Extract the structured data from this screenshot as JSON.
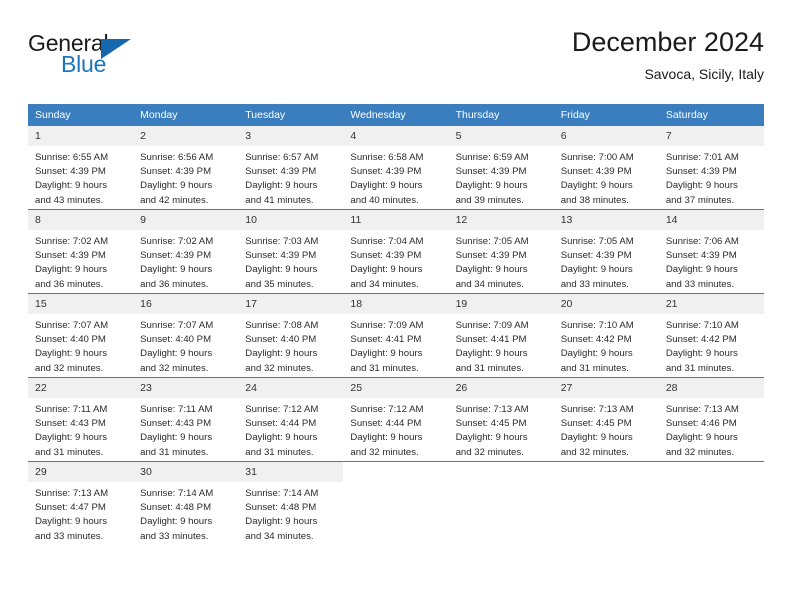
{
  "brand": {
    "name_top": "General",
    "name_bottom": "Blue",
    "flag_icon": "blue-triangle-flag",
    "accent_color": "#1567ae",
    "header_color": "#3a7ebf"
  },
  "header": {
    "title": "December 2024",
    "subtitle": "Savoca, Sicily, Italy"
  },
  "weekdays": [
    "Sunday",
    "Monday",
    "Tuesday",
    "Wednesday",
    "Thursday",
    "Friday",
    "Saturday"
  ],
  "weeks": [
    [
      {
        "day": "1",
        "sunrise": "Sunrise: 6:55 AM",
        "sunset": "Sunset: 4:39 PM",
        "daylight_line1": "Daylight: 9 hours",
        "daylight_line2": "and 43 minutes."
      },
      {
        "day": "2",
        "sunrise": "Sunrise: 6:56 AM",
        "sunset": "Sunset: 4:39 PM",
        "daylight_line1": "Daylight: 9 hours",
        "daylight_line2": "and 42 minutes."
      },
      {
        "day": "3",
        "sunrise": "Sunrise: 6:57 AM",
        "sunset": "Sunset: 4:39 PM",
        "daylight_line1": "Daylight: 9 hours",
        "daylight_line2": "and 41 minutes."
      },
      {
        "day": "4",
        "sunrise": "Sunrise: 6:58 AM",
        "sunset": "Sunset: 4:39 PM",
        "daylight_line1": "Daylight: 9 hours",
        "daylight_line2": "and 40 minutes."
      },
      {
        "day": "5",
        "sunrise": "Sunrise: 6:59 AM",
        "sunset": "Sunset: 4:39 PM",
        "daylight_line1": "Daylight: 9 hours",
        "daylight_line2": "and 39 minutes."
      },
      {
        "day": "6",
        "sunrise": "Sunrise: 7:00 AM",
        "sunset": "Sunset: 4:39 PM",
        "daylight_line1": "Daylight: 9 hours",
        "daylight_line2": "and 38 minutes."
      },
      {
        "day": "7",
        "sunrise": "Sunrise: 7:01 AM",
        "sunset": "Sunset: 4:39 PM",
        "daylight_line1": "Daylight: 9 hours",
        "daylight_line2": "and 37 minutes."
      }
    ],
    [
      {
        "day": "8",
        "sunrise": "Sunrise: 7:02 AM",
        "sunset": "Sunset: 4:39 PM",
        "daylight_line1": "Daylight: 9 hours",
        "daylight_line2": "and 36 minutes."
      },
      {
        "day": "9",
        "sunrise": "Sunrise: 7:02 AM",
        "sunset": "Sunset: 4:39 PM",
        "daylight_line1": "Daylight: 9 hours",
        "daylight_line2": "and 36 minutes."
      },
      {
        "day": "10",
        "sunrise": "Sunrise: 7:03 AM",
        "sunset": "Sunset: 4:39 PM",
        "daylight_line1": "Daylight: 9 hours",
        "daylight_line2": "and 35 minutes."
      },
      {
        "day": "11",
        "sunrise": "Sunrise: 7:04 AM",
        "sunset": "Sunset: 4:39 PM",
        "daylight_line1": "Daylight: 9 hours",
        "daylight_line2": "and 34 minutes."
      },
      {
        "day": "12",
        "sunrise": "Sunrise: 7:05 AM",
        "sunset": "Sunset: 4:39 PM",
        "daylight_line1": "Daylight: 9 hours",
        "daylight_line2": "and 34 minutes."
      },
      {
        "day": "13",
        "sunrise": "Sunrise: 7:05 AM",
        "sunset": "Sunset: 4:39 PM",
        "daylight_line1": "Daylight: 9 hours",
        "daylight_line2": "and 33 minutes."
      },
      {
        "day": "14",
        "sunrise": "Sunrise: 7:06 AM",
        "sunset": "Sunset: 4:39 PM",
        "daylight_line1": "Daylight: 9 hours",
        "daylight_line2": "and 33 minutes."
      }
    ],
    [
      {
        "day": "15",
        "sunrise": "Sunrise: 7:07 AM",
        "sunset": "Sunset: 4:40 PM",
        "daylight_line1": "Daylight: 9 hours",
        "daylight_line2": "and 32 minutes."
      },
      {
        "day": "16",
        "sunrise": "Sunrise: 7:07 AM",
        "sunset": "Sunset: 4:40 PM",
        "daylight_line1": "Daylight: 9 hours",
        "daylight_line2": "and 32 minutes."
      },
      {
        "day": "17",
        "sunrise": "Sunrise: 7:08 AM",
        "sunset": "Sunset: 4:40 PM",
        "daylight_line1": "Daylight: 9 hours",
        "daylight_line2": "and 32 minutes."
      },
      {
        "day": "18",
        "sunrise": "Sunrise: 7:09 AM",
        "sunset": "Sunset: 4:41 PM",
        "daylight_line1": "Daylight: 9 hours",
        "daylight_line2": "and 31 minutes."
      },
      {
        "day": "19",
        "sunrise": "Sunrise: 7:09 AM",
        "sunset": "Sunset: 4:41 PM",
        "daylight_line1": "Daylight: 9 hours",
        "daylight_line2": "and 31 minutes."
      },
      {
        "day": "20",
        "sunrise": "Sunrise: 7:10 AM",
        "sunset": "Sunset: 4:42 PM",
        "daylight_line1": "Daylight: 9 hours",
        "daylight_line2": "and 31 minutes."
      },
      {
        "day": "21",
        "sunrise": "Sunrise: 7:10 AM",
        "sunset": "Sunset: 4:42 PM",
        "daylight_line1": "Daylight: 9 hours",
        "daylight_line2": "and 31 minutes."
      }
    ],
    [
      {
        "day": "22",
        "sunrise": "Sunrise: 7:11 AM",
        "sunset": "Sunset: 4:43 PM",
        "daylight_line1": "Daylight: 9 hours",
        "daylight_line2": "and 31 minutes."
      },
      {
        "day": "23",
        "sunrise": "Sunrise: 7:11 AM",
        "sunset": "Sunset: 4:43 PM",
        "daylight_line1": "Daylight: 9 hours",
        "daylight_line2": "and 31 minutes."
      },
      {
        "day": "24",
        "sunrise": "Sunrise: 7:12 AM",
        "sunset": "Sunset: 4:44 PM",
        "daylight_line1": "Daylight: 9 hours",
        "daylight_line2": "and 31 minutes."
      },
      {
        "day": "25",
        "sunrise": "Sunrise: 7:12 AM",
        "sunset": "Sunset: 4:44 PM",
        "daylight_line1": "Daylight: 9 hours",
        "daylight_line2": "and 32 minutes."
      },
      {
        "day": "26",
        "sunrise": "Sunrise: 7:13 AM",
        "sunset": "Sunset: 4:45 PM",
        "daylight_line1": "Daylight: 9 hours",
        "daylight_line2": "and 32 minutes."
      },
      {
        "day": "27",
        "sunrise": "Sunrise: 7:13 AM",
        "sunset": "Sunset: 4:45 PM",
        "daylight_line1": "Daylight: 9 hours",
        "daylight_line2": "and 32 minutes."
      },
      {
        "day": "28",
        "sunrise": "Sunrise: 7:13 AM",
        "sunset": "Sunset: 4:46 PM",
        "daylight_line1": "Daylight: 9 hours",
        "daylight_line2": "and 32 minutes."
      }
    ],
    [
      {
        "day": "29",
        "sunrise": "Sunrise: 7:13 AM",
        "sunset": "Sunset: 4:47 PM",
        "daylight_line1": "Daylight: 9 hours",
        "daylight_line2": "and 33 minutes."
      },
      {
        "day": "30",
        "sunrise": "Sunrise: 7:14 AM",
        "sunset": "Sunset: 4:48 PM",
        "daylight_line1": "Daylight: 9 hours",
        "daylight_line2": "and 33 minutes."
      },
      {
        "day": "31",
        "sunrise": "Sunrise: 7:14 AM",
        "sunset": "Sunset: 4:48 PM",
        "daylight_line1": "Daylight: 9 hours",
        "daylight_line2": "and 34 minutes."
      },
      {
        "day": "",
        "sunrise": "",
        "sunset": "",
        "daylight_line1": "",
        "daylight_line2": ""
      },
      {
        "day": "",
        "sunrise": "",
        "sunset": "",
        "daylight_line1": "",
        "daylight_line2": ""
      },
      {
        "day": "",
        "sunrise": "",
        "sunset": "",
        "daylight_line1": "",
        "daylight_line2": ""
      },
      {
        "day": "",
        "sunrise": "",
        "sunset": "",
        "daylight_line1": "",
        "daylight_line2": ""
      }
    ]
  ]
}
